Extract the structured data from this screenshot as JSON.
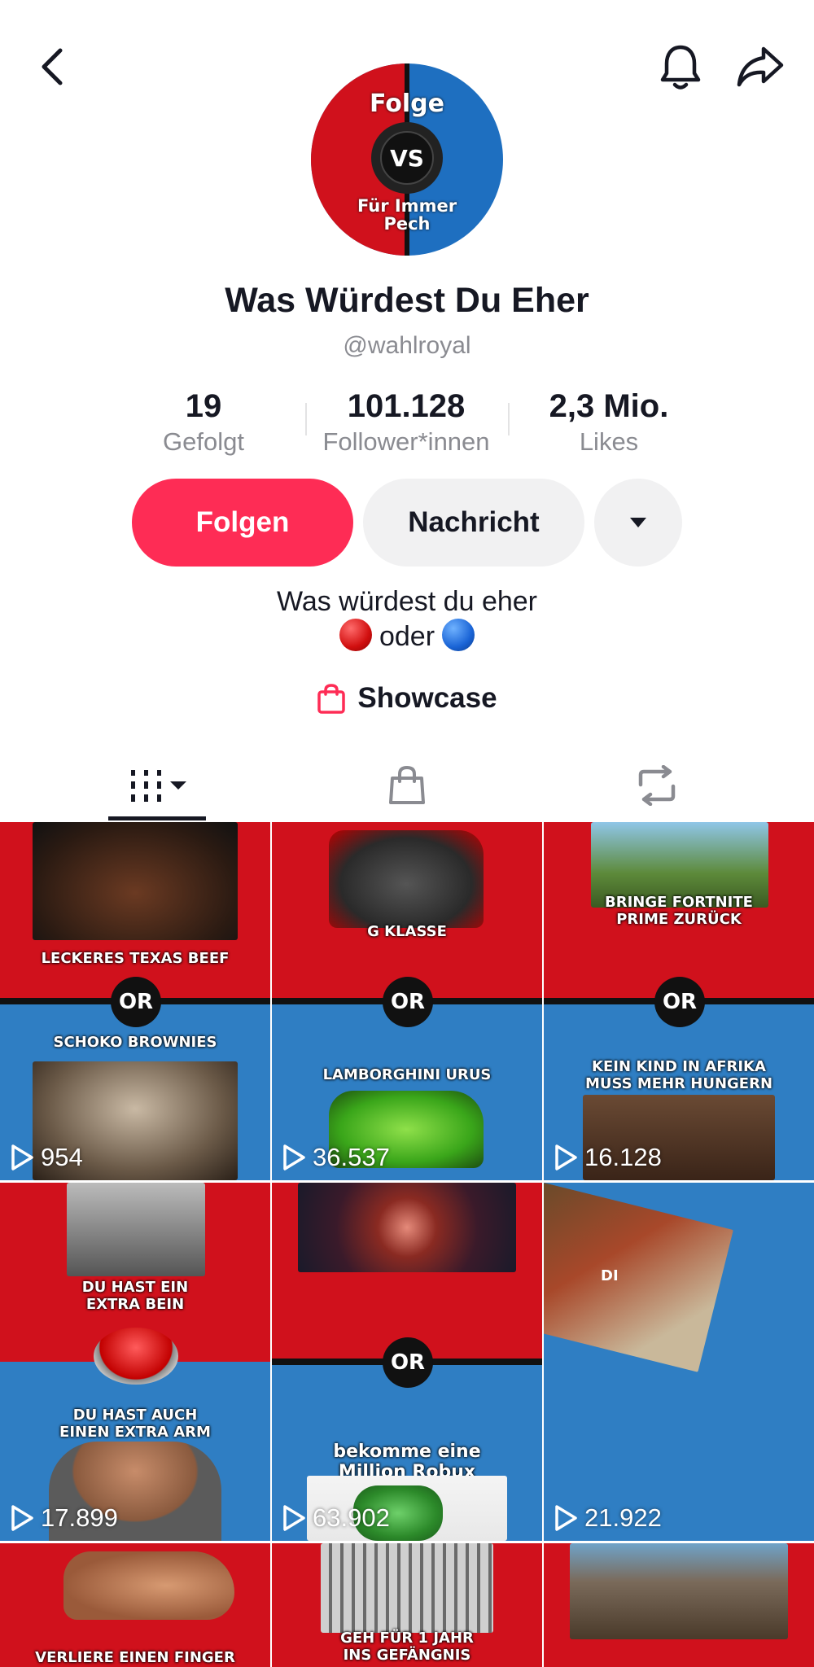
{
  "profile": {
    "display_name": "Was Würdest Du Eher",
    "handle": "@wahlroyal",
    "avatar": {
      "top_text": "Folge",
      "center_text": "VS",
      "bottom_text": "Für Immer Pech"
    }
  },
  "stats": [
    {
      "value": "19",
      "label": "Gefolgt"
    },
    {
      "value": "101.128",
      "label": "Follower*innen"
    },
    {
      "value": "2,3 Mio.",
      "label": "Likes"
    }
  ],
  "actions": {
    "follow_label": "Folgen",
    "message_label": "Nachricht"
  },
  "bio": {
    "line1": "Was würdest du eher",
    "line2": "oder"
  },
  "showcase_label": "Showcase",
  "tabs": [
    "videos-tab",
    "shop-tab",
    "reposts-tab"
  ],
  "videos": [
    {
      "top_caption": "Leckeres Texas Beef",
      "bottom_caption": "Schoko Brownies",
      "or_label": "OR",
      "views": "954"
    },
    {
      "top_caption": "G Klasse",
      "bottom_caption": "Lamborghini Urus",
      "or_label": "OR",
      "views": "36.537"
    },
    {
      "top_caption": "Bringe Fortnite Prime zurück",
      "bottom_caption": "Kein Kind in Afrika muss mehr hungern",
      "or_label": "OR",
      "views": "16.128"
    },
    {
      "top_caption": "Du hast ein extra Bein",
      "bottom_caption": "Du hast auch einen extra Arm",
      "or_label": "",
      "views": "17.899"
    },
    {
      "top_caption": "",
      "bottom_caption": "bekomme eine Million Robux",
      "or_label": "OR",
      "views": "63.902"
    },
    {
      "top_caption": "DI",
      "bottom_caption": "",
      "or_label": "",
      "views": "21.922"
    },
    {
      "top_caption": "Verliere einen Finger",
      "bottom_caption": "",
      "or_label": "",
      "views": ""
    },
    {
      "top_caption": "Geh für 1 Jahr ins Gefängnis",
      "bottom_caption": "",
      "or_label": "",
      "views": ""
    },
    {
      "top_caption": "",
      "bottom_caption": "",
      "or_label": "",
      "views": ""
    }
  ],
  "colors": {
    "accent": "#fe2c55",
    "red_panel": "#d0111c",
    "blue_panel": "#2f7ec3"
  }
}
